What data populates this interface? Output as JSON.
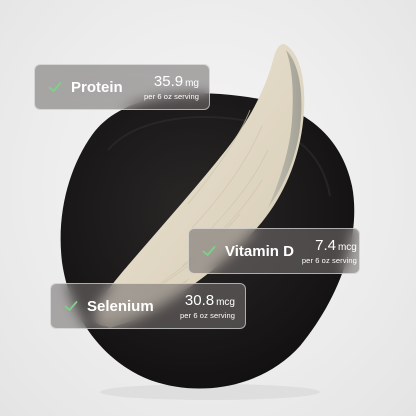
{
  "image": {
    "subject": "fish-fillet-on-plate"
  },
  "accent_colors": {
    "check": "#7bd28a",
    "card_bg": "#767070",
    "plate": "#1a1818",
    "fillet": "#e3dccb"
  },
  "cards": [
    {
      "icon": "check-icon",
      "nutrient": "Protein",
      "amount": "35.9",
      "unit": "mg",
      "basis": "per 6 oz serving"
    },
    {
      "icon": "check-icon",
      "nutrient": "Vitamin D",
      "amount": "7.4",
      "unit": "mcg",
      "basis": "per 6 oz serving"
    },
    {
      "icon": "check-icon",
      "nutrient": "Selenium",
      "amount": "30.8",
      "unit": "mcg",
      "basis": "per 6 oz serving"
    }
  ]
}
